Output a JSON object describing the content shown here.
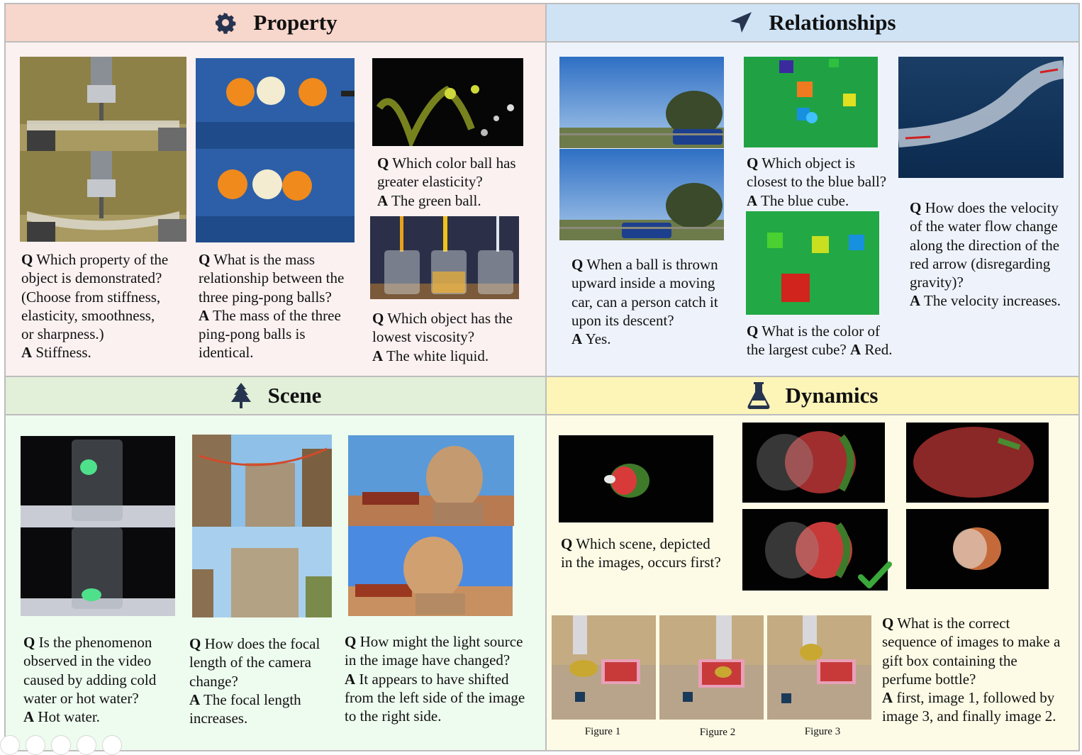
{
  "sections": {
    "property": {
      "title": "Property",
      "icon": "gear-icon",
      "header_color": "#f7d6cc",
      "body_color": "#fbf1f1"
    },
    "relationships": {
      "title": "Relationships",
      "icon": "paper-plane-icon",
      "header_color": "#cfe3f5",
      "body_color": "#eef3fb"
    },
    "scene": {
      "title": "Scene",
      "icon": "pine-tree-icon",
      "header_color": "#e2efd9",
      "body_color": "#eefbef"
    },
    "dynamics": {
      "title": "Dynamics",
      "icon": "flask-icon",
      "header_color": "#fdf4b8",
      "body_color": "#fdfbe6"
    }
  },
  "qa": {
    "property_1": {
      "q": "Which property of the\nobject is demonstrated?\n(Choose from stiffness,\nelasticity, smoothness,\nor sharpness.)",
      "a": "Stiffness."
    },
    "property_2": {
      "q": "What is the mass\nrelationship between the\nthree ping-pong balls?",
      "a": "The mass of the three\nping-pong balls is\nidentical."
    },
    "property_3": {
      "q": "Which color ball has\ngreater elasticity?",
      "a": "The green ball."
    },
    "property_4": {
      "q": "Which object has the\nlowest viscosity?",
      "a": "The white liquid."
    },
    "relationships_1": {
      "q": "When a ball is thrown\nupward inside a moving\ncar, can a person catch it\nupon its descent?",
      "a": "Yes."
    },
    "relationships_2": {
      "q": "Which object is\nclosest to the blue ball?",
      "a": "The blue cube."
    },
    "relationships_3": {
      "q": "What is the color of\nthe largest cube?",
      "a": "Red."
    },
    "relationships_4": {
      "q": "How does the velocity\nof the water flow change\nalong the direction of the\nred arrow (disregarding\ngravity)?",
      "a": " The velocity increases."
    },
    "scene_1": {
      "q": "Is the phenomenon\nobserved in the video\ncaused by adding cold\nwater or hot water?",
      "a": "Hot water."
    },
    "scene_2": {
      "q": "How does the focal\nlength of the camera\nchange?",
      "a": "The focal length\nincreases."
    },
    "scene_3": {
      "q": "How might the light source\nin the image have changed?",
      "a": "It appears to have shifted\nfrom the left side of the image\nto the right side."
    },
    "dynamics_1": {
      "q": "Which scene, depicted\nin the images, occurs first?",
      "a": ""
    },
    "dynamics_2": {
      "q": "What is the correct\nsequence of images to make a\ngift box containing the\nperfume bottle?",
      "a": "first, image 1, followed by\nimage 3, and finally image 2."
    }
  },
  "labels": {
    "q": "Q",
    "a": "A"
  },
  "figures": [
    "Figure 1",
    "Figure 2",
    "Figure 3"
  ],
  "answer_mark": "checkmark-icon"
}
